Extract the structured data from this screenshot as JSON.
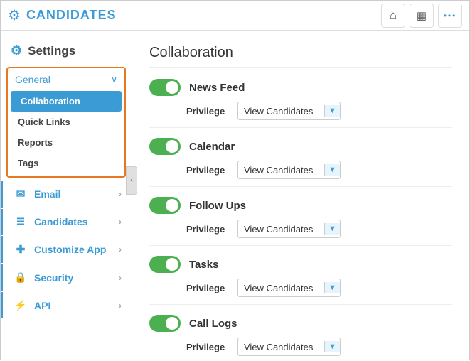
{
  "header": {
    "title": "CANDIDATES",
    "home_icon": "home-icon",
    "chart_icon": "chart-icon",
    "more_icon": "more-icon"
  },
  "sidebar": {
    "settings_label": "Settings",
    "general": {
      "label": "General",
      "items": [
        {
          "label": "Collaboration",
          "active": true
        },
        {
          "label": "Quick Links",
          "active": false
        },
        {
          "label": "Reports",
          "active": false
        },
        {
          "label": "Tags",
          "active": false
        }
      ]
    },
    "nav_items": [
      {
        "label": "Email",
        "icon": "email-icon"
      },
      {
        "label": "Candidates",
        "icon": "candidates-icon"
      },
      {
        "label": "Customize App",
        "icon": "customize-icon"
      },
      {
        "label": "Security",
        "icon": "security-icon"
      },
      {
        "label": "API",
        "icon": "api-icon"
      }
    ]
  },
  "content": {
    "title": "Collaboration",
    "features": [
      {
        "name": "News Feed",
        "enabled": true,
        "privilege_label": "Privilege",
        "privilege_value": "View Candidates"
      },
      {
        "name": "Calendar",
        "enabled": true,
        "privilege_label": "Privilege",
        "privilege_value": "View Candidates"
      },
      {
        "name": "Follow Ups",
        "enabled": true,
        "privilege_label": "Privilege",
        "privilege_value": "View Candidates"
      },
      {
        "name": "Tasks",
        "enabled": true,
        "privilege_label": "Privilege",
        "privilege_value": "View Candidates"
      },
      {
        "name": "Call Logs",
        "enabled": true,
        "privilege_label": "Privilege",
        "privilege_value": "View Candidates"
      }
    ]
  },
  "colors": {
    "accent": "#3a9bd5",
    "toggle_on": "#4caf50",
    "border_orange": "#e87722"
  }
}
